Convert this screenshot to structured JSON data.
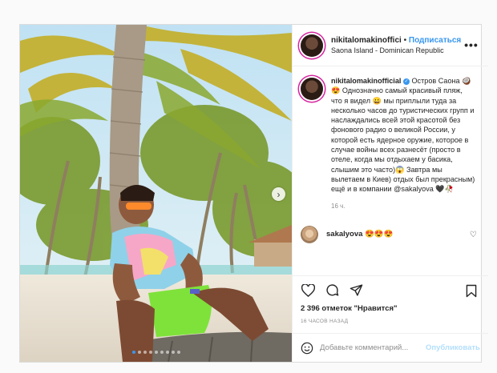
{
  "post": {
    "username": "nikitalomakinoffici",
    "separator": "•",
    "follow_label": "Подписаться",
    "location": "Saona Island - Dominican Republic",
    "more_label": "•••"
  },
  "caption": {
    "username": "nikitalomakinofficial",
    "text": "Остров Саона 🥥😍 Однозначно самый красивый пляж, что я видел 😀 мы приплыли туда за несколько часов до туристических групп и наслаждались всей этой красотой без фонового радио о великой России, у которой есть ядерное оружие, которое в случае войны всех разнесёт (просто в отеле, когда мы отдыхаем у басика, слышим это часто)😱 Завтра мы вылетаем в Киев) отдых был прекрасным) ещё и в компании @sakalyova 🖤🥀",
    "time": "16 ч."
  },
  "comment": {
    "username": "sakalyova",
    "text": "😍😍😍"
  },
  "likes_text": "2 396 отметок \"Нравится\"",
  "posted_ago": "16 ЧАСОВ НАЗАД",
  "add_comment": {
    "placeholder": "Добавьте комментарий...",
    "publish_label": "Опубликовать"
  },
  "carousel": {
    "slides": 9,
    "active": 0
  },
  "colors": {
    "accent": "#3897f0",
    "publish_disabled": "#b2dffc",
    "border": "#dbdbdb"
  }
}
